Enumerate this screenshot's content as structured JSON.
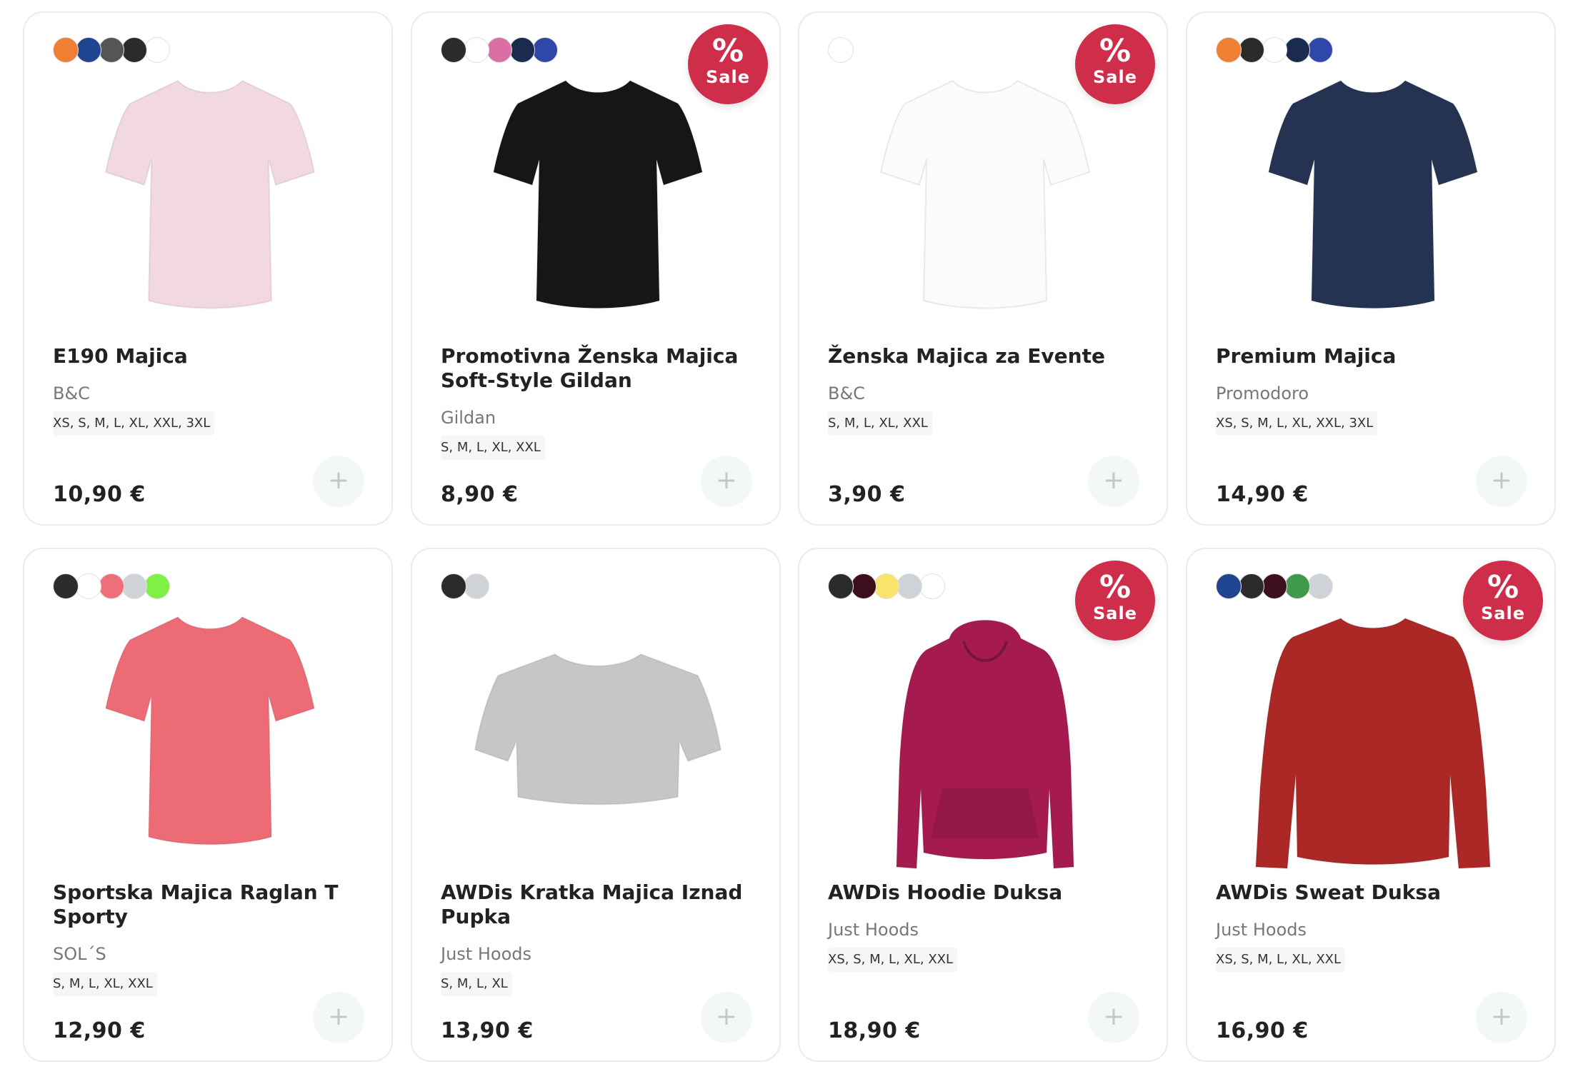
{
  "products": [
    {
      "title": "E190 Majica",
      "brand": "B&C",
      "sizes": "XS, S, M, L, XL, XXL, 3XL",
      "price": "10,90 €",
      "sale": false,
      "garment_type": "tshirt",
      "garment_color": "#f2d8df",
      "swatches": [
        "#ef8033",
        "#1f4590",
        "#555555",
        "#2b2b2b",
        "#ffffff"
      ]
    },
    {
      "title": "Promotivna Ženska Majica Soft-Style Gildan",
      "brand": "Gildan",
      "sizes": "S, M, L, XL, XXL",
      "price": "8,90 €",
      "sale": true,
      "garment_type": "tshirt",
      "garment_color": "#161616",
      "swatches": [
        "#2b2b2b",
        "#ffffff",
        "#d96fa5",
        "#1b2b4d",
        "#2f47a8"
      ]
    },
    {
      "title": "Ženska Majica za Evente",
      "brand": "B&C",
      "sizes": "S, M, L, XL, XXL",
      "price": "3,90 €",
      "sale": true,
      "garment_type": "tshirt",
      "garment_color": "#fbfbfb",
      "swatches": [
        "#ffffff"
      ]
    },
    {
      "title": "Premium Majica",
      "brand": "Promodoro",
      "sizes": "XS, S, M, L, XL, XXL, 3XL",
      "price": "14,90 €",
      "sale": false,
      "garment_type": "tshirt",
      "garment_color": "#253352",
      "swatches": [
        "#ef8033",
        "#2b2b2b",
        "#ffffff",
        "#1b2b4d",
        "#2f47a8"
      ]
    },
    {
      "title": "Sportska Majica Raglan T Sporty",
      "brand": "SOL´S",
      "sizes": "S, M, L, XL, XXL",
      "price": "12,90 €",
      "sale": false,
      "garment_type": "tshirt",
      "garment_color": "#ec6b75",
      "swatches": [
        "#2b2b2b",
        "#ffffff",
        "#ef6e7b",
        "#cfd2d6",
        "#7ef046"
      ]
    },
    {
      "title": "AWDis Kratka Majica Iznad Pupka",
      "brand": "Just Hoods",
      "sizes": "S, M, L, XL",
      "price": "13,90 €",
      "sale": false,
      "garment_type": "crop",
      "garment_color": "#c6c6c6",
      "swatches": [
        "#2b2b2b",
        "#cfd2d6"
      ]
    },
    {
      "title": "AWDis Hoodie Duksa",
      "brand": "Just Hoods",
      "sizes": "XS, S, M, L, XL, XXL",
      "price": "18,90 €",
      "sale": true,
      "garment_type": "hoodie",
      "garment_color": "#a51b4f",
      "swatches": [
        "#2b2b2b",
        "#3d0f1c",
        "#f9e46b",
        "#cfd2d6",
        "#ffffff"
      ]
    },
    {
      "title": "AWDis Sweat Duksa",
      "brand": "Just Hoods",
      "sizes": "XS, S, M, L, XL, XXL",
      "price": "16,90 €",
      "sale": true,
      "garment_type": "sweat",
      "garment_color": "#ab2826",
      "swatches": [
        "#1f4590",
        "#2b2b2b",
        "#3d0f1c",
        "#3f9a4c",
        "#cfd2d6"
      ]
    }
  ],
  "sale_badge": {
    "symbol": "%",
    "label": "Sale"
  },
  "add_button_symbol": "+"
}
